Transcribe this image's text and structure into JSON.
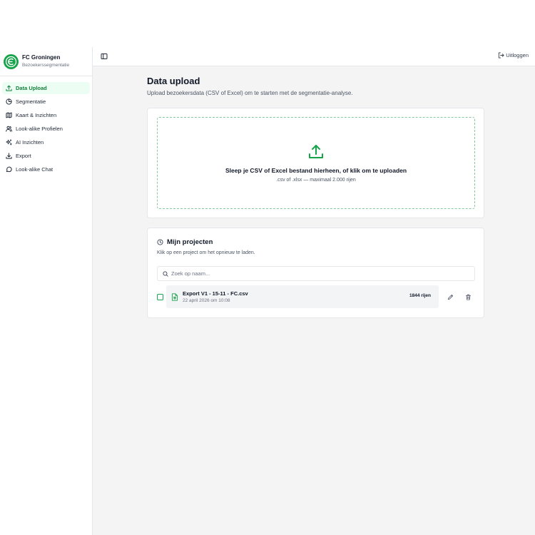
{
  "brand": {
    "title": "FC Groningen",
    "subtitle": "Bezoekerssegmentatie"
  },
  "sidebar": {
    "items": [
      {
        "label": "Data Upload",
        "icon": "upload-icon",
        "active": true
      },
      {
        "label": "Segmentatie",
        "icon": "pie-chart-icon",
        "active": false
      },
      {
        "label": "Kaart & Inzichten",
        "icon": "map-icon",
        "active": false
      },
      {
        "label": "Look-alike Profielen",
        "icon": "users-icon",
        "active": false
      },
      {
        "label": "AI Inzichten",
        "icon": "sparkles-icon",
        "active": false
      },
      {
        "label": "Export",
        "icon": "download-icon",
        "active": false
      },
      {
        "label": "Look-alike Chat",
        "icon": "chat-icon",
        "active": false
      }
    ]
  },
  "topbar": {
    "logout_label": "Uitloggen"
  },
  "page": {
    "title": "Data upload",
    "subtitle": "Upload bezoekersdata (CSV of Excel) om te starten met de segmentatie-analyse."
  },
  "dropzone": {
    "title": "Sleep je CSV of Excel bestand hierheen, of klik om te uploaden",
    "hint": ".csv of .xlsx — maximaal 2.000 rijen"
  },
  "projects": {
    "title": "Mijn projecten",
    "subtitle": "Klik op een project om het opnieuw te laden.",
    "search_placeholder": "Zoek op naam...",
    "items": [
      {
        "name": "Export V1 - 15-11 - FC.csv",
        "date": "22 april 2026 om 10:08",
        "rows": "1844 rijen"
      }
    ]
  },
  "colors": {
    "accent": "#16a34a",
    "active_bg": "#ecfdf3",
    "background": "#f4f4f5"
  }
}
